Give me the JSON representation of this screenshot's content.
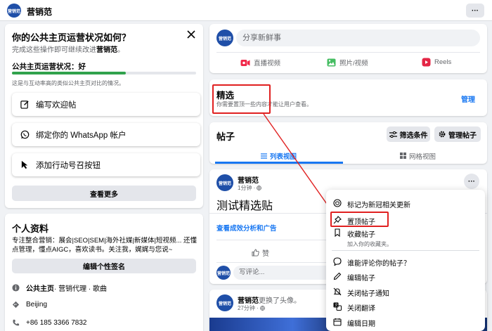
{
  "topbar": {
    "page_name": "营销范",
    "logo_text": "营销范",
    "more_label": "···"
  },
  "status_card": {
    "title": "你的公共主页运营状况如何？",
    "subtitle_prefix": "完成这些操作即可继续改进",
    "subtitle_name": "营销范",
    "subtitle_suffix": "。",
    "status_label": "公共主页运营状况：",
    "status_value": "好",
    "progress_fraction": 0.62,
    "comparison_note": "这是与互动率高的类似公共主页对比的情况。",
    "actions": [
      "编写欢迎帖",
      "绑定你的 WhatsApp 帐户",
      "添加行动号召按钮"
    ],
    "see_more": "查看更多"
  },
  "profile_card": {
    "title": "个人资料",
    "intro": "专注整合营销：展会|SEO|SEM|海外社媒|新媒体|短视频... 还懂点管理，懂点AIGC，喜欢读书。关注我，娓娓与您说~",
    "edit_bio": "编辑个性签名",
    "category_prefix": "公共主页",
    "category_rest": " · 营销代理 · 歌曲",
    "location": "Beijing",
    "phone": "+86 185 3366 7832"
  },
  "composer": {
    "placeholder": "分享新鲜事",
    "actions": [
      "直播视频",
      "照片/视频",
      "Reels"
    ]
  },
  "featured": {
    "title": "精选",
    "subtitle": "你需要置顶一些内容才能让用户查看。",
    "manage": "管理"
  },
  "posts_section": {
    "title": "帖子",
    "filter": "筛选条件",
    "manage_posts": "管理帖子",
    "tab_list": "列表视图",
    "tab_grid": "网格视图"
  },
  "post1": {
    "author": "营销范",
    "time": "1分钟 ·",
    "content": "测试精选贴",
    "insights_link": "查看成效分析和广告",
    "like": "赞",
    "comment_placeholder": "写评论..."
  },
  "post2": {
    "author": "营销范",
    "action": "更换了头像。",
    "time": "27分钟 ·"
  },
  "context_menu": {
    "items": [
      {
        "title": "标记为新冠相关更新",
        "sub": ""
      },
      {
        "title": "置顶帖子",
        "sub": ""
      },
      {
        "title": "收藏帖子",
        "sub": "加入你的收藏夹。"
      },
      {
        "title": "谁能评论你的帖子？",
        "sub": ""
      },
      {
        "title": "编辑帖子",
        "sub": ""
      },
      {
        "title": "关闭帖子通知",
        "sub": ""
      },
      {
        "title": "关闭翻译",
        "sub": ""
      },
      {
        "title": "编辑日期",
        "sub": ""
      }
    ]
  },
  "colors": {
    "accent": "#1877f2",
    "highlight": "#e02020",
    "progress": "#31a24c"
  }
}
